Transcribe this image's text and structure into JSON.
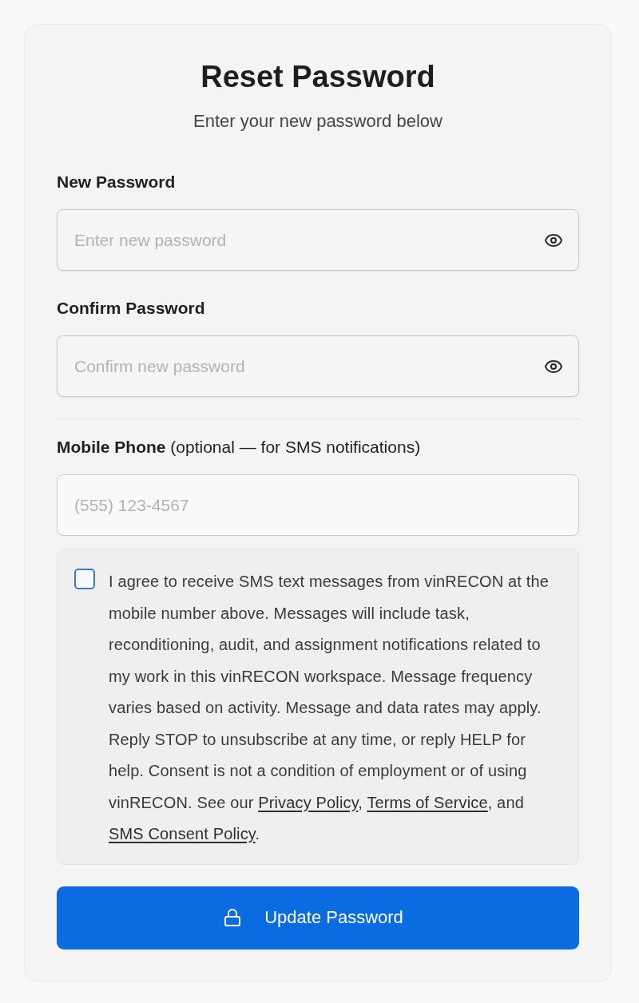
{
  "card": {
    "title": "Reset Password",
    "subtitle": "Enter your new password below"
  },
  "password_fields": [
    {
      "label": "New Password",
      "placeholder": "Enter new password"
    },
    {
      "label": "Confirm Password",
      "placeholder": "Confirm new password"
    }
  ],
  "phone_field": {
    "label": "**Mobile Phone** (optional — for SMS notifications)",
    "placeholder": "(555) 123-4567"
  },
  "consent": {
    "checked": false,
    "segments": [
      {
        "kind": "text",
        "text": "I agree to receive SMS text messages from vinRECON at the mobile number above. Messages will include task, reconditioning, audit, and assignment notifications related to my work in this vinRECON workspace. Message frequency varies based on activity. Message and data rates may apply. Reply STOP to unsubscribe at any time, or reply HELP for help. Consent is not a condition of employment or of using vinRECON. See our "
      },
      {
        "kind": "link",
        "text": "Privacy Policy"
      },
      {
        "kind": "text",
        "text": ", "
      },
      {
        "kind": "link",
        "text": "Terms of Service"
      },
      {
        "kind": "text",
        "text": ", and "
      },
      {
        "kind": "link",
        "text": "SMS Consent Policy"
      },
      {
        "kind": "text",
        "text": "."
      }
    ]
  },
  "submit_button": {
    "label": "Update Password"
  }
}
